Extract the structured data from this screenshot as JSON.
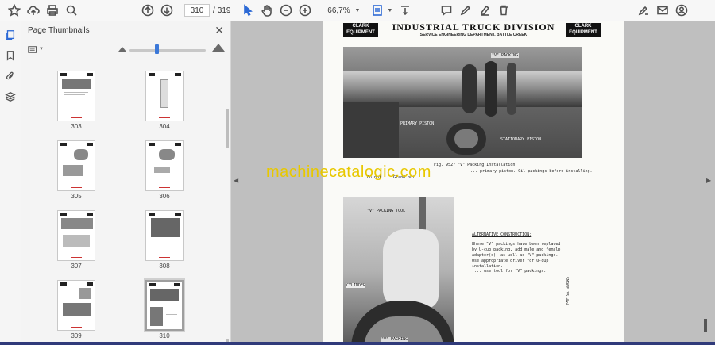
{
  "toolbar": {
    "page_current": "310",
    "page_separator": "/",
    "page_total": "319",
    "zoom": "66,7%",
    "icons": [
      "bookmark-star-icon",
      "cloud-upload-icon",
      "print-icon",
      "zoom-search-icon",
      "page-up-icon",
      "page-down-icon",
      "select-arrow-icon",
      "hand-tool-icon",
      "zoom-out-icon",
      "zoom-in-icon",
      "fit-page-icon",
      "scroll-mode-icon",
      "comment-icon",
      "pencil-icon",
      "highlight-icon",
      "delete-icon",
      "sign-icon",
      "mail-icon",
      "account-icon"
    ]
  },
  "sidebar": {
    "icons": [
      "thumbnails-icon",
      "bookmark-icon",
      "attachment-icon",
      "layers-icon"
    ]
  },
  "panel": {
    "title": "Page Thumbnails",
    "close": "✕",
    "thumbnails": [
      {
        "label": "303"
      },
      {
        "label": "304"
      },
      {
        "label": "305"
      },
      {
        "label": "306"
      },
      {
        "label": "307"
      },
      {
        "label": "308"
      },
      {
        "label": "309"
      },
      {
        "label": "310"
      }
    ]
  },
  "document": {
    "logo_left": "CLARK EQUIPMENT",
    "logo_right": "CLARK EQUIPMENT",
    "header": "INDUSTRIAL TRUCK DIVISION",
    "subheader": "SERVICE ENGINEERING DEPARTMENT, BATTLE CREEK",
    "photo1_labels": {
      "v_packing": "\"V\" PACKING",
      "primary_piston": "PRIMARY PISTON",
      "stationary_piston": "STATIONARY PISTON"
    },
    "fig_caption": "Fig. 9527 \"V\" Packing Installation",
    "fig_text_1": "... primary piston. Oil packings before installing.",
    "fig_text_2": "Do not ... Gland nut ...",
    "photo2_labels": {
      "tool": "\"V\" PACKING TOOL",
      "cylinder": "CYLINDER",
      "v_packing": "\"V\" PACKING"
    },
    "alt_heading": "ALTERNATIVE CONSTRUCTION:",
    "alt_text": "Where \"V\" packings have been replaced by U-cup packing, add male and female adapter(s), as well as \"V\" packings. Use appropriate driver for U-cup installation.",
    "alt_text_2": ".... use tool for \"V\" packings.",
    "side_code": "SM90F 35-4x4",
    "watermark": "machinecatalogic.com"
  }
}
